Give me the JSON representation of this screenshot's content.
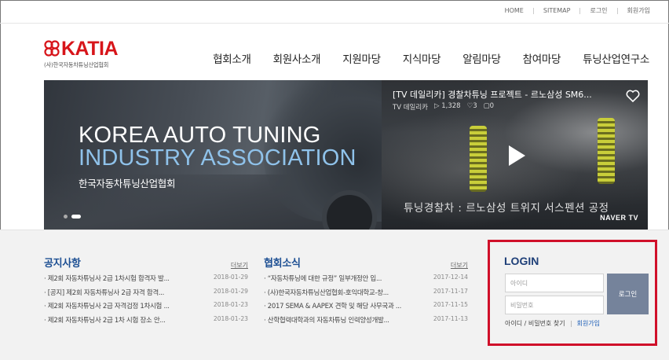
{
  "util_nav": [
    "HOME",
    "SITEMAP",
    "로그인",
    "회원가입"
  ],
  "logo": {
    "word": "KATIA",
    "subtitle": "(사)한국자동차튜닝산업협회"
  },
  "gnb": [
    "협회소개",
    "회원사소개",
    "지원마당",
    "지식마당",
    "알림마당",
    "참여마당",
    "튜닝산업연구소"
  ],
  "hero": {
    "line1": "KOREA AUTO TUNING",
    "line2": "INDUSTRY ASSOCIATION",
    "line3": "한국자동차튜닝산업협회"
  },
  "video": {
    "title": "[TV 데일리카] 경찰차튜닝 프로젝트 - 르노삼성 SM6...",
    "channel": "TV 데일리카",
    "plays": "▷ 1,328",
    "likes": "♡3",
    "comments": "▢0",
    "caption": "튜닝경찰차 : 르노삼성 트위지 서스펜션 공정",
    "brand": "NAVER TV"
  },
  "notice": {
    "title": "공지사항",
    "more": "더보기",
    "items": [
      {
        "text": "· 제2회 자동차튜닝사 2급 1차시험 합격자 발...",
        "date": "2018-01-29"
      },
      {
        "text": "· [공지] 제2회 자동차튜닝사 2급 자격 합격...",
        "date": "2018-01-29"
      },
      {
        "text": "· 제2회 자동차튜닝사 2급 자격검정 1차시험 ...",
        "date": "2018-01-23"
      },
      {
        "text": "· 제2회 자동차튜닝사 2급 1차 시험 장소 안...",
        "date": "2018-01-23"
      }
    ]
  },
  "news": {
    "title": "협회소식",
    "more": "더보기",
    "items": [
      {
        "text": "· “자동차튜닝에 대한 규정” 일부개정안 입...",
        "date": "2017-12-14"
      },
      {
        "text": "· (사)한국자동차튜닝산업협회-호익대학교-창...",
        "date": "2017-11-17"
      },
      {
        "text": "· 2017 SEMA & AAPEX 견학 및 해당 사무국과 ...",
        "date": "2017-11-15"
      },
      {
        "text": "· 산학협력대학과의 자동차튜닝 인력양성개발...",
        "date": "2017-11-13"
      }
    ]
  },
  "login": {
    "title": "LOGIN",
    "id_placeholder": "아이디",
    "pw_placeholder": "비밀번호",
    "button": "로그인",
    "find": "아이디 / 비밀번호 찾기",
    "join": "회원가입"
  },
  "colors": {
    "brand_red": "#d7151a",
    "board_title": "#1d4f93",
    "login_border": "#d0102a",
    "login_button": "#75839b"
  }
}
